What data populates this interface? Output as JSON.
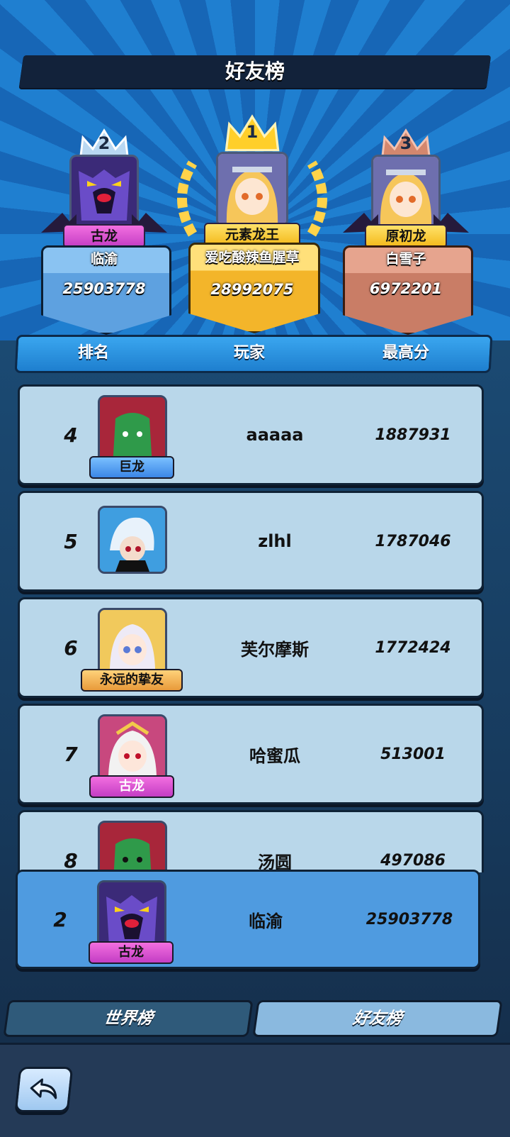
{
  "title": "好友榜",
  "podium": [
    {
      "rank": "2",
      "badge": "古龙",
      "name": "临渝",
      "score": "25903778"
    },
    {
      "rank": "1",
      "badge": "元素龙王",
      "name": "爱吃酸辣鱼腥草",
      "score": "28992075"
    },
    {
      "rank": "3",
      "badge": "原初龙",
      "name": "白雪子",
      "score": "6972201"
    }
  ],
  "headers": {
    "rank": "排名",
    "player": "玩家",
    "score": "最高分"
  },
  "rows": [
    {
      "rank": "4",
      "badge": "巨龙",
      "name": "aaaaa",
      "score": "1887931"
    },
    {
      "rank": "5",
      "badge": "",
      "name": "zlhl",
      "score": "1787046"
    },
    {
      "rank": "6",
      "badge": "永远的挚友",
      "name": "芙尔摩斯",
      "score": "1772424"
    },
    {
      "rank": "7",
      "badge": "古龙",
      "name": "哈蜜瓜",
      "score": "513001"
    },
    {
      "rank": "8",
      "badge": "",
      "name": "汤圆",
      "score": "497086"
    }
  ],
  "self_row": {
    "rank": "2",
    "badge": "古龙",
    "name": "临渝",
    "score": "25903778"
  },
  "tabs": {
    "world": "世界榜",
    "friends": "好友榜"
  },
  "icons": {
    "back": "back-arrow-icon"
  }
}
